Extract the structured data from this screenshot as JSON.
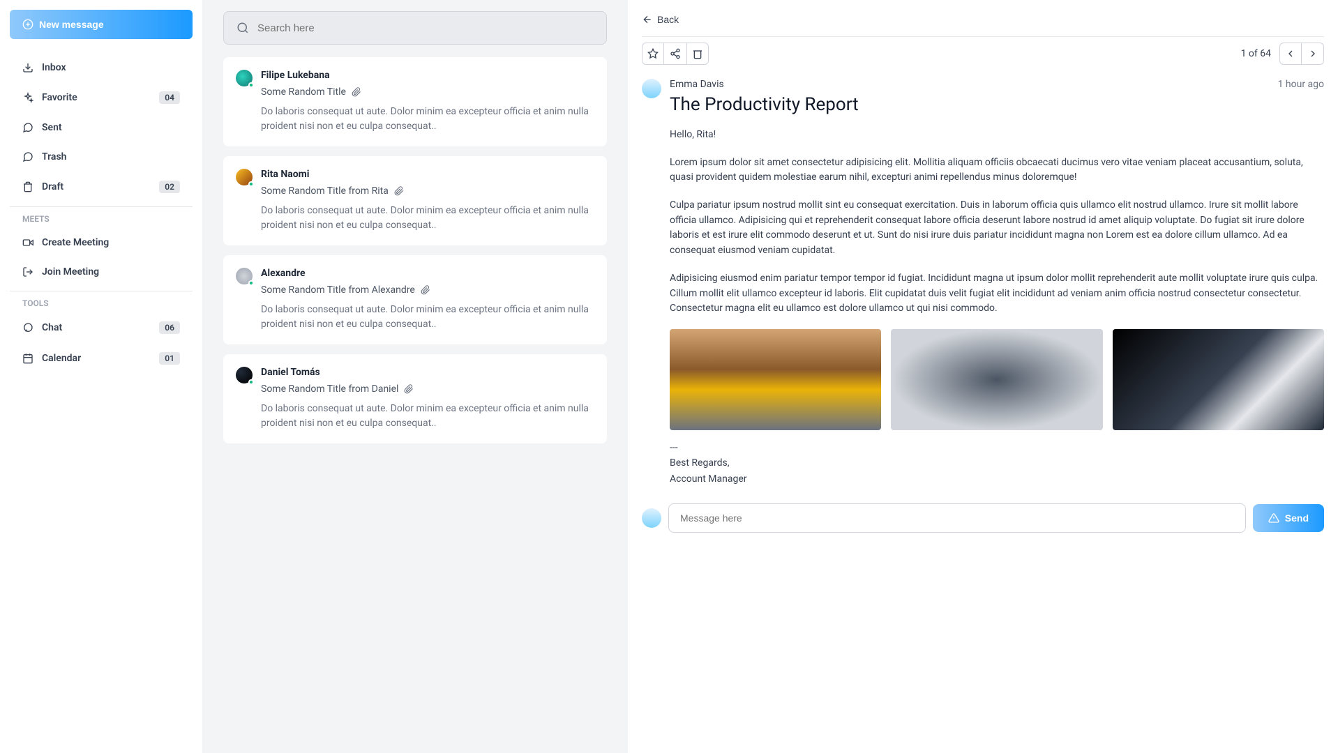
{
  "sidebar": {
    "new_message": "New message",
    "nav": [
      {
        "label": "Inbox",
        "badge": null
      },
      {
        "label": "Favorite",
        "badge": "04"
      },
      {
        "label": "Sent",
        "badge": null
      },
      {
        "label": "Trash",
        "badge": null
      },
      {
        "label": "Draft",
        "badge": "02"
      }
    ],
    "meets_title": "MEETS",
    "meets": [
      {
        "label": "Create Meeting"
      },
      {
        "label": "Join Meeting"
      }
    ],
    "tools_title": "TOOLS",
    "tools": [
      {
        "label": "Chat",
        "badge": "06"
      },
      {
        "label": "Calendar",
        "badge": "01"
      }
    ]
  },
  "search": {
    "placeholder": "Search here"
  },
  "emails": [
    {
      "sender": "Filipe Lukebana",
      "title": "Some Random Title",
      "preview": "Do laboris consequat ut aute. Dolor minim ea excepteur officia et anim nulla proident nisi non et eu culpa consequat.."
    },
    {
      "sender": "Rita Naomi",
      "title": "Some Random Title from Rita",
      "preview": "Do laboris consequat ut aute. Dolor minim ea excepteur officia et anim nulla proident nisi non et eu culpa consequat.."
    },
    {
      "sender": "Alexandre",
      "title": "Some Random Title from Alexandre",
      "preview": "Do laboris consequat ut aute. Dolor minim ea excepteur officia et anim nulla proident nisi non et eu culpa consequat.."
    },
    {
      "sender": "Daniel Tomás",
      "title": "Some Random Title from Daniel",
      "preview": "Do laboris consequat ut aute. Dolor minim ea excepteur officia et anim nulla proident nisi non et eu culpa consequat.."
    }
  ],
  "detail": {
    "back": "Back",
    "count": "1 of 64",
    "sender": "Emma Davis",
    "timestamp": "1 hour ago",
    "subject": "The Productivity Report",
    "greeting": "Hello, Rita!",
    "p1": "Lorem ipsum dolor sit amet consectetur adipisicing elit. Mollitia aliquam officiis obcaecati ducimus vero vitae veniam placeat accusantium, soluta, quasi provident quidem molestiae earum nihil, excepturi animi repellendus minus doloremque!",
    "p2": "Culpa pariatur ipsum nostrud mollit sint eu consequat exercitation. Duis in laborum officia quis ullamco elit nostrud ullamco. Irure sit mollit labore officia ullamco. Adipisicing qui et reprehenderit consequat labore officia deserunt labore nostrud id amet aliquip voluptate. Do fugiat sit irure dolore laboris et est irure elit commodo deserunt et ut. Sunt do nisi irure duis pariatur incididunt magna non Lorem est ea dolore cillum ullamco. Ad ea consequat eiusmod veniam cupidatat.",
    "p3": "Adipisicing eiusmod enim pariatur tempor tempor id fugiat. Incididunt magna ut ipsum dolor mollit reprehenderit aute mollit voluptate irure quis culpa. Cillum mollit elit ullamco excepteur id laboris. Elit cupidatat duis velit fugiat elit incididunt ad veniam anim officia nostrud consectetur consectetur. Consectetur magna elit eu ullamco est dolore ullamco ut qui nisi commodo.",
    "divider": "---",
    "closing1": "Best Regards,",
    "closing2": "Account Manager",
    "reply_placeholder": "Message here",
    "send_label": "Send"
  }
}
